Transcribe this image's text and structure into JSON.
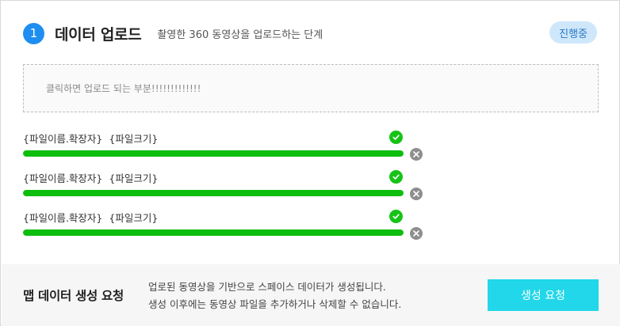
{
  "header": {
    "step_number": "1",
    "title": "데이터 업로드",
    "subtitle": "촬영한 360 동영상을 업로드하는 단계",
    "status_badge": "진행중"
  },
  "dropzone": {
    "text": "클릭하면 업로드 되는 부분!!!!!!!!!!!!!"
  },
  "files": [
    {
      "name": "{파일이름.확장자}",
      "size": "{파일크기}",
      "progress": 1.0,
      "status_icon": "check-circle-icon",
      "remove_icon": "close-circle-icon"
    },
    {
      "name": "{파일이름.확장자}",
      "size": "{파일크기}",
      "progress": 1.0,
      "status_icon": "check-circle-icon",
      "remove_icon": "close-circle-icon"
    },
    {
      "name": "{파일이름.확장자}",
      "size": "{파일크기}",
      "progress": 1.0,
      "status_icon": "check-circle-icon",
      "remove_icon": "close-circle-icon"
    }
  ],
  "footer": {
    "title": "맵 데이터 생성 요청",
    "desc_line1": "업로된 동영상을 기반으로 스페이스 데이터가 생성됩니다.",
    "desc_line2": "생성 이후에는 동영상 파일을 추가하거나 삭제할 수 없습니다.",
    "submit_label": "생성 요청"
  },
  "colors": {
    "accent": "#1e8ef0",
    "progress": "#0dbe0d",
    "button": "#21d7e9",
    "badge_bg": "#cfe7fb"
  }
}
